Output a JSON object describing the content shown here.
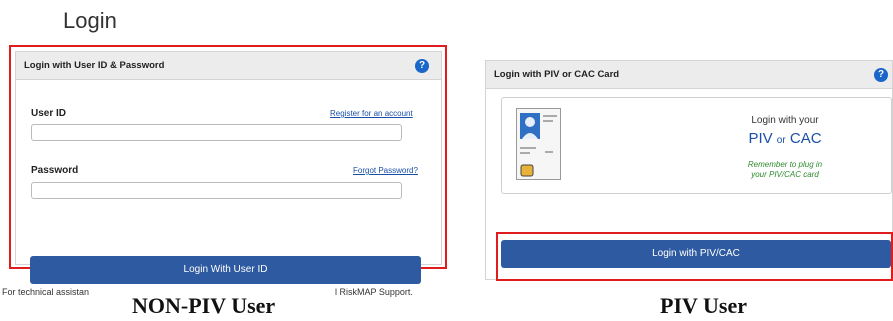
{
  "page": {
    "title": "Login"
  },
  "left_panel": {
    "header": "Login with User ID & Password",
    "help_icon": "?",
    "user_id_label": "User ID",
    "register_link": "Register for an account",
    "password_label": "Password",
    "forgot_link": "Forgot Password?",
    "login_button": "Login With User ID"
  },
  "right_panel": {
    "header": "Login with PIV or CAC Card",
    "help_icon": "?",
    "login_with_your": "Login with your",
    "piv_text": "PIV",
    "or_text": "or",
    "cac_text": "CAC",
    "remember_line1": "Remember to plug in",
    "remember_line2": "your PIV/CAC card",
    "login_button": "Login with PIV/CAC"
  },
  "footer": {
    "left_text": "For technical assistan",
    "right_text": "l RiskMAP Support."
  },
  "captions": {
    "non_piv": "NON-PIV User",
    "piv": "PIV User"
  },
  "colors": {
    "accent_button": "#2e5aa1",
    "help_icon": "#1a66c9",
    "highlight_outline": "#e01c1c",
    "link": "#1a4fa8",
    "remember_text": "#2e8b2e"
  }
}
